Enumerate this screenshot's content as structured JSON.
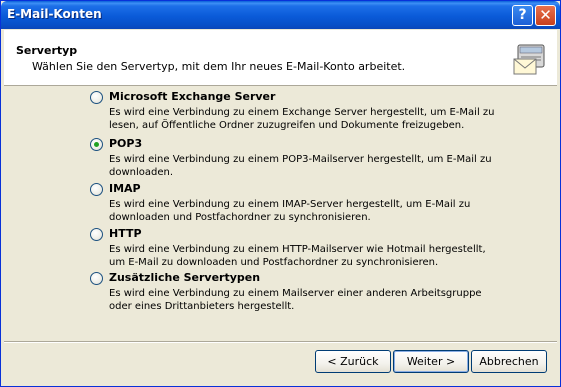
{
  "window": {
    "title": "E-Mail-Konten"
  },
  "titlebar": {
    "help_label": "?",
    "close_label": "✕"
  },
  "header": {
    "title": "Servertyp",
    "subtitle": "Wählen Sie den Servertyp, mit dem Ihr neues E-Mail-Konto arbeitet.",
    "icon": "mail-server-icon"
  },
  "options": [
    {
      "label": "Microsoft Exchange Server",
      "description": "Es wird eine Verbindung zu einem Exchange Server hergestellt, um E-Mail zu lesen, auf Öffentliche Ordner zuzugreifen und Dokumente freizugeben.",
      "checked": false
    },
    {
      "label": "POP3",
      "description": "Es wird eine Verbindung zu einem POP3-Mailserver hergestellt, um E-Mail zu downloaden.",
      "checked": true
    },
    {
      "label": "IMAP",
      "description": "Es wird eine Verbindung zu einem IMAP-Server hergestellt, um E-Mail zu downloaden und Postfachordner zu synchronisieren.",
      "checked": false
    },
    {
      "label": "HTTP",
      "description": "Es wird eine Verbindung zu einem HTTP-Mailserver wie Hotmail hergestellt, um E-Mail zu downloaden und Postfachordner zu synchronisieren.",
      "checked": false
    },
    {
      "label": "Zusätzliche Servertypen",
      "description": "Es wird eine Verbindung zu einem Mailserver einer anderen Arbeitsgruppe oder eines Drittanbieters hergestellt.",
      "checked": false
    }
  ],
  "buttons": {
    "back": "< Zurück",
    "next": "Weiter >",
    "cancel": "Abbrechen"
  },
  "colors": {
    "titlebar": "#0a5ad8",
    "face": "#ece9d8",
    "radio_dot": "#21a121"
  }
}
